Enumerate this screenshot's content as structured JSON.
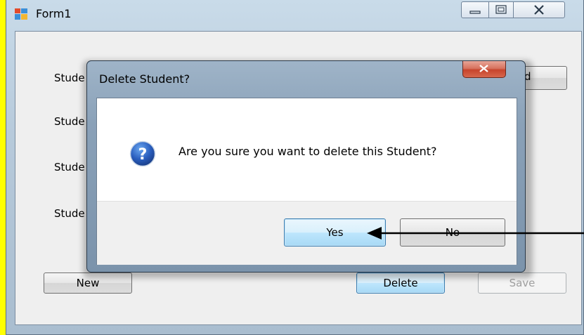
{
  "window": {
    "title": "Form1",
    "labels": [
      "Stude",
      "Stude",
      "Stude",
      "Stude"
    ],
    "partial_button_text": "d",
    "buttons": {
      "new": "New",
      "delete": "Delete",
      "save": "Save"
    }
  },
  "dialog": {
    "title": "Delete Student?",
    "message": "Are you sure you want to delete this Student?",
    "yes": "Yes",
    "no": "No",
    "icon": "question-icon"
  },
  "colors": {
    "background": "#ffff00",
    "focus_accent": "#3c7fb1",
    "close_red": "#c7442c"
  }
}
